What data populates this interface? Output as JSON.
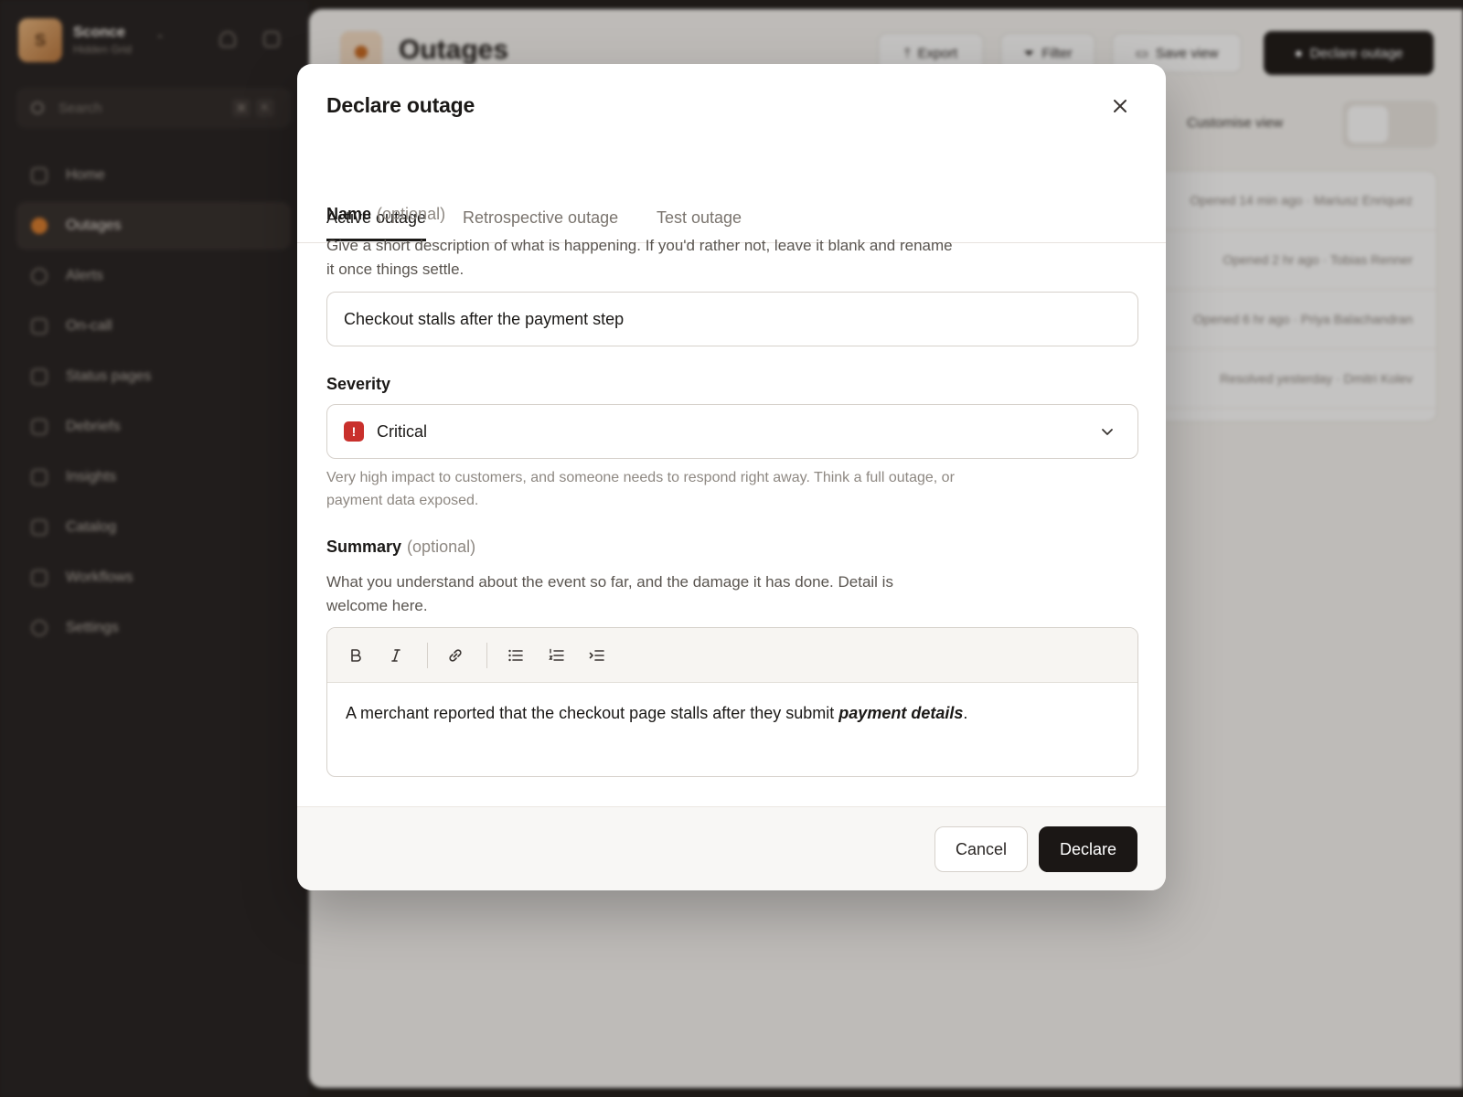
{
  "app": {
    "org": {
      "initial": "S",
      "name": "Sconce",
      "sub": "Hidden Grid"
    },
    "search": {
      "placeholder": "Search",
      "kbd1": "⌘",
      "kbd2": "K"
    },
    "nav": [
      {
        "label": "Home",
        "active": false
      },
      {
        "label": "Outages",
        "active": true
      },
      {
        "label": "Alerts",
        "active": false
      },
      {
        "label": "On-call",
        "active": false
      },
      {
        "label": "Status pages",
        "active": false
      },
      {
        "label": "Debriefs",
        "active": false
      },
      {
        "label": "Insights",
        "active": false
      },
      {
        "label": "Catalog",
        "active": false
      },
      {
        "label": "Workflows",
        "active": false
      },
      {
        "label": "Settings",
        "active": false
      }
    ],
    "page_title": "Outages",
    "toolbar": {
      "export": "Export",
      "filter": "Filter",
      "save_view": "Save view",
      "declare": "Declare outage"
    },
    "customise_view": "Customise view",
    "rows": [
      "Opened 14 min ago · Mariusz Enriquez",
      "Opened 2 hr ago · Tobias Renner",
      "Opened 6 hr ago · Priya Balachandran",
      "Resolved yesterday · Dmitri Kolev"
    ]
  },
  "modal": {
    "title": "Declare outage",
    "tabs": [
      "Active outage",
      "Retrospective outage",
      "Test outage"
    ],
    "active_tab": "Active outage",
    "name": {
      "label": "Name",
      "optional": "(optional)",
      "help": "Give a short description of what is happening. If you'd rather not, leave it blank and rename it once things settle.",
      "value": "Checkout stalls after the payment step"
    },
    "severity": {
      "label": "Severity",
      "value": "Critical",
      "badge_color": "#c9302c",
      "help": "Very high impact to customers, and someone needs to respond right away. Think a full outage, or payment data exposed."
    },
    "summary": {
      "label": "Summary",
      "optional": "(optional)",
      "help": "What you understand about the event so far, and the damage it has done. Detail is welcome here.",
      "text_before": "A merchant reported that the checkout page stalls after they submit ",
      "text_bold": "payment details",
      "text_after": ".",
      "toolbar_icons": [
        "bold-icon",
        "italic-icon",
        "link-icon",
        "bullet-list-icon",
        "numbered-list-icon",
        "indent-icon"
      ]
    },
    "buttons": {
      "cancel": "Cancel",
      "declare": "Declare"
    }
  }
}
